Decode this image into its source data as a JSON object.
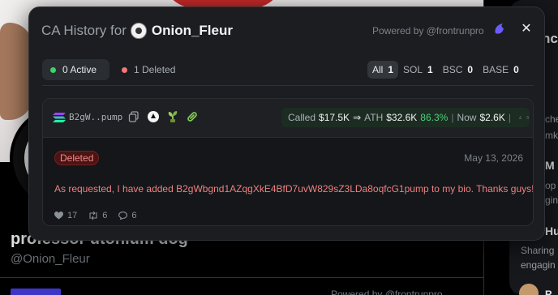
{
  "popup": {
    "title_prefix": "CA History for",
    "username": "Onion_Fleur",
    "powered_by": "Powered by @frontrunpro",
    "close_glyph": "✕"
  },
  "filters": {
    "active": {
      "label": "0 Active",
      "color": "#3dd36b"
    },
    "deleted": {
      "label": "1 Deleted",
      "color": "#f07878"
    }
  },
  "chains": [
    {
      "name": "All",
      "count": "1",
      "selected": true
    },
    {
      "name": "SOL",
      "count": "1",
      "selected": false
    },
    {
      "name": "BSC",
      "count": "0",
      "selected": false
    },
    {
      "name": "BASE",
      "count": "0",
      "selected": false
    }
  ],
  "card": {
    "token": "B2gW..pump",
    "icons": [
      "copy-icon",
      "pump-icon",
      "plant-icon",
      "link-icon"
    ],
    "stats": {
      "called_label": "Called",
      "called_value": "$17.5K",
      "arrow": "⇒",
      "ath_label": "ATH",
      "ath_value": "$32.6K",
      "ath_pct": "86.3%",
      "sep": "|",
      "now_label": "Now",
      "now_value": "$2.6K"
    },
    "status": "Deleted",
    "date": "May 13, 2026",
    "text": "As requested, I have added B2gWbgnd1AZqgXkE4BfD7uvW829sZ3LDa8oqfcG1pump to my bio. Thanks guys!",
    "likes": "17",
    "retweets": "6",
    "replies": "6"
  },
  "background": {
    "display_name": "professor utonium dog",
    "handle": "@Onion_Fleur",
    "powered_bottom": "Powered by @frontrunpro",
    "sidebar_fragments": [
      "nc",
      "che",
      "mk",
      "M",
      "op",
      "gin",
      "Hu",
      "Sharing",
      "engagin",
      "R"
    ]
  },
  "colors": {
    "accent": "#6a5cff",
    "positive": "#4cd07d",
    "deleted": "#f08080"
  }
}
